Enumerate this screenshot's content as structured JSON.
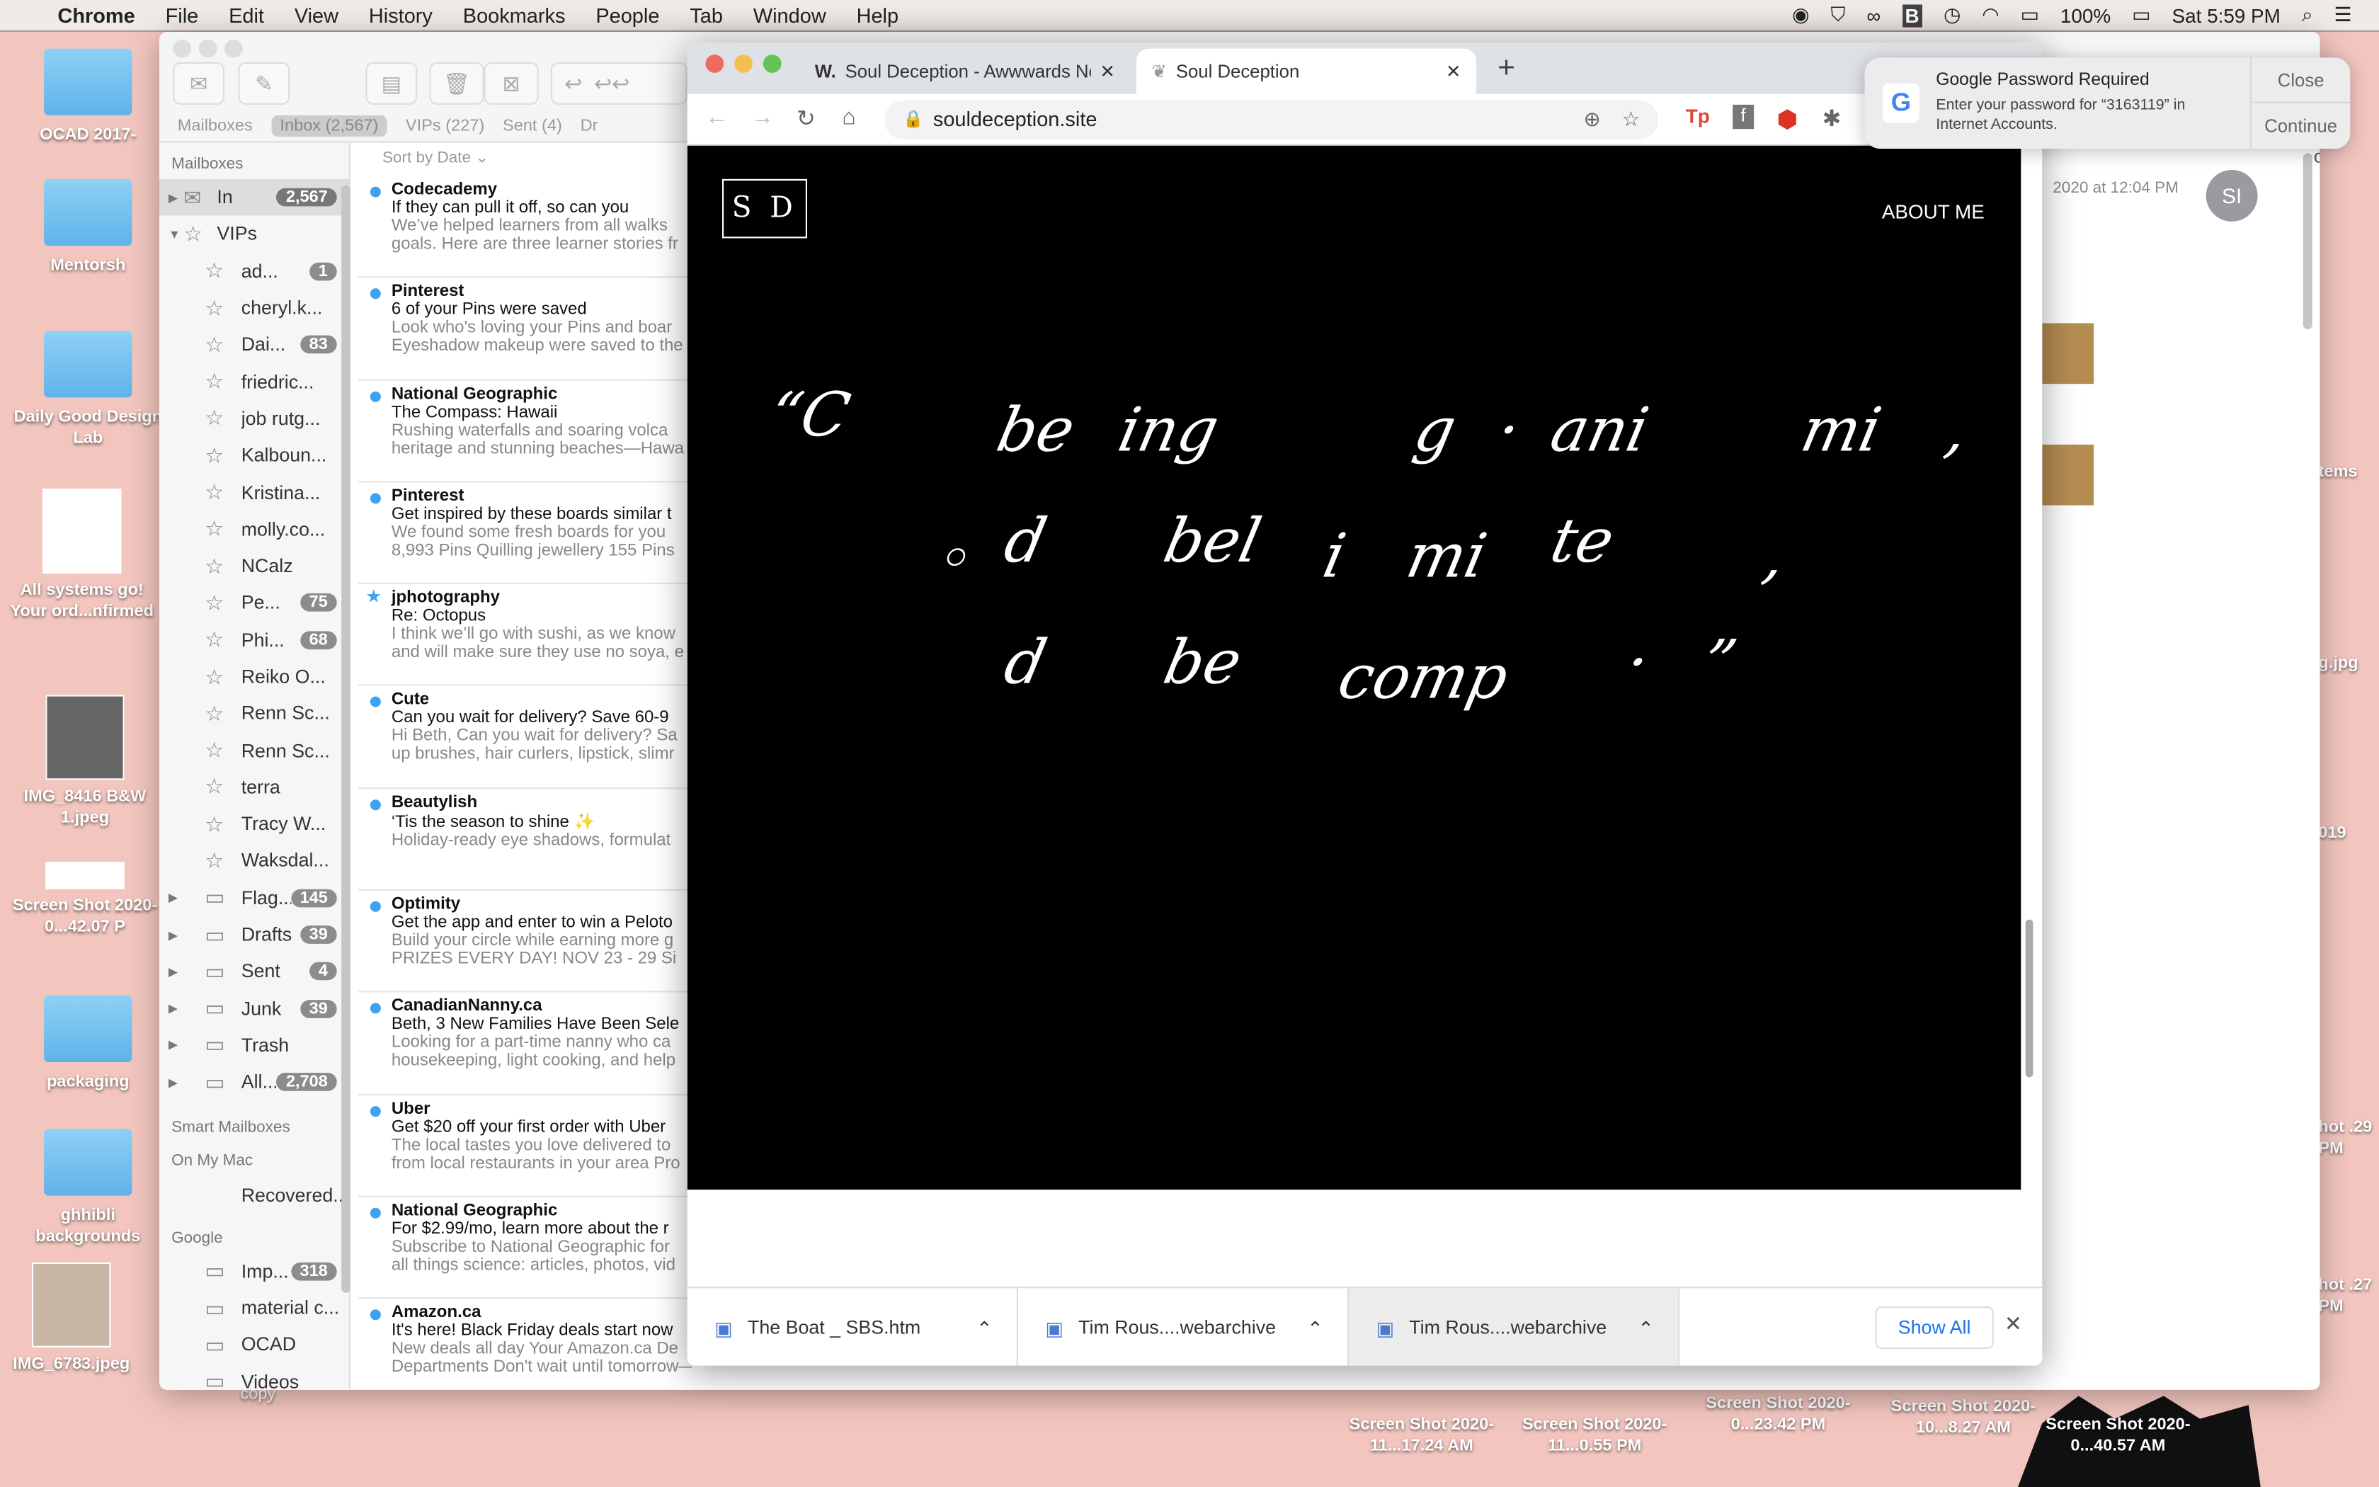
{
  "menubar": {
    "app": "Chrome",
    "items": [
      "File",
      "Edit",
      "View",
      "History",
      "Bookmarks",
      "People",
      "Tab",
      "Window",
      "Help"
    ],
    "battery": "100%",
    "clock": "Sat 5:59 PM"
  },
  "desktop": {
    "left": [
      "OCAD 2017-",
      "Mentorsh",
      "Daily Good Design Lab",
      "All systems go! Your ord...nfirmed",
      "IMG_8416 B&W 1.jpeg",
      "Screen Shot 2020-0...42.07 P",
      "packaging",
      "ghhibli backgrounds",
      "IMG_6783.jpeg"
    ],
    "bottom": [
      "Screen Shot 2020-11...17.24 AM",
      "Screen Shot 2020-11...0.55 PM",
      "Screen Shot 2020-0...23.42 PM",
      "Screen Shot 2020-10...8.27 AM",
      "Screen Shot 2020-0...40.57 AM"
    ],
    "right": [
      "n.ca items",
      "g.jpg",
      "019",
      "hot .29 PM",
      "hot .27 PM"
    ],
    "copy": "copy"
  },
  "mail": {
    "favorites": [
      "Mailboxes",
      "Inbox (2,567)",
      "VIPs (227)",
      "Sent (4)",
      "Dr"
    ],
    "sidebar": {
      "header": "Mailboxes",
      "inbox": {
        "label": "In",
        "count": "2,567"
      },
      "vips": "VIPs",
      "vip_items": [
        {
          "label": "ad...",
          "count": "1"
        },
        {
          "label": "cheryl.k..."
        },
        {
          "label": "Dai...",
          "count": "83"
        },
        {
          "label": "friedric..."
        },
        {
          "label": "job rutg..."
        },
        {
          "label": "Kalboun..."
        },
        {
          "label": "Kristina..."
        },
        {
          "label": "molly.co..."
        },
        {
          "label": "NCalz"
        },
        {
          "label": "Pe...",
          "count": "75"
        },
        {
          "label": "Phi...",
          "count": "68"
        },
        {
          "label": "Reiko O..."
        },
        {
          "label": "Renn Sc..."
        },
        {
          "label": "Renn Sc..."
        },
        {
          "label": "terra"
        },
        {
          "label": "Tracy W..."
        },
        {
          "label": "Waksdal..."
        }
      ],
      "boxes": [
        {
          "label": "Flag...",
          "count": "145"
        },
        {
          "label": "Drafts",
          "count": "39"
        },
        {
          "label": "Sent",
          "count": "4"
        },
        {
          "label": "Junk",
          "count": "39"
        },
        {
          "label": "Trash"
        },
        {
          "label": "All...",
          "count": "2,708"
        }
      ],
      "smart": "Smart Mailboxes",
      "onmac": "On My Mac",
      "recovered": "Recovered...",
      "google": "Google",
      "google_items": [
        {
          "label": "Imp...",
          "count": "318"
        },
        {
          "label": "material c..."
        },
        {
          "label": "OCAD"
        },
        {
          "label": "Videos"
        }
      ]
    },
    "sort": "Sort by Date",
    "messages": [
      {
        "from": "Codecademy",
        "subject": "If they can pull it off, so can you",
        "preview": [
          "We’ve helped learners from all walks",
          "goals. Here are three learner stories fr"
        ]
      },
      {
        "from": "Pinterest",
        "subject": "6 of your Pins were saved",
        "preview": [
          "Look who's loving your Pins and boar",
          "Eyeshadow makeup were saved to the"
        ]
      },
      {
        "from": "National Geographic",
        "subject": "The Compass: Hawaii",
        "preview": [
          "Rushing waterfalls and soaring volca",
          "heritage and stunning beaches—Hawa"
        ]
      },
      {
        "from": "Pinterest",
        "subject": "Get inspired by these boards similar t",
        "preview": [
          "We found some fresh boards for you",
          "8,993 Pins Quilling jewellery 155 Pins"
        ]
      },
      {
        "from": "jphotography",
        "subject": "Re: Octopus",
        "preview": [
          "I think we’ll go with sushi, as we know",
          "and will make sure they use no soya, e"
        ],
        "starred": true
      },
      {
        "from": "Cute",
        "subject": "Can you wait for delivery? Save 60-9",
        "preview": [
          "Hi Beth, Can you wait for delivery? Sa",
          "up brushes, hair curlers, lipstick, slimr"
        ]
      },
      {
        "from": "Beautylish",
        "subject": "‘Tis the season to shine ✨",
        "preview": [
          "Holiday-ready eye shadows, formulat",
          ""
        ]
      },
      {
        "from": "Optimity",
        "subject": "Get the app and enter to win a Peloto",
        "preview": [
          "Build your circle while earning more g",
          "PRIZES EVERY DAY!  NOV 23 - 29   Si"
        ]
      },
      {
        "from": "CanadianNanny.ca",
        "subject": "Beth, 3 New Families Have Been Sele",
        "preview": [
          "Looking for a part-time nanny who ca",
          "housekeeping, light cooking, and help"
        ]
      },
      {
        "from": "Uber",
        "subject": "Get $20 off your first order with Uber",
        "preview": [
          "The local tastes you love delivered to",
          "from local restaurants in your area Pro"
        ]
      },
      {
        "from": "National Geographic",
        "subject": "For $2.99/mo, learn more about the r",
        "preview": [
          "Subscribe to National Geographic for",
          "all things science: articles, photos, vid"
        ]
      },
      {
        "from": "Amazon.ca",
        "subject": "It's here! Black Friday deals start now",
        "preview": [
          "New deals all day Your Amazon.ca De",
          "Departments Don't wait until tomorrow—Black Friday deals..."
        ]
      }
    ],
    "detail": {
      "date": "2020 at 12:04 PM",
      "avatar": "SI",
      "of": "of"
    }
  },
  "chrome": {
    "tabs": [
      {
        "icon": "W.",
        "title": "Soul Deception - Awwwards No"
      },
      {
        "title": "Soul Deception"
      }
    ],
    "url": "souldeception.site",
    "page": {
      "logo": "S D",
      "nav": "ABOUT ME",
      "words": [
        "“C",
        "be",
        "ing",
        "g",
        "·",
        "ani",
        "mi",
        "‚",
        "◦",
        "d",
        "bel",
        "i",
        "mi",
        "te",
        "‚",
        "d",
        "be",
        "comp",
        "·",
        "”"
      ]
    },
    "downloads": [
      "The Boat _ SBS.htm",
      "Tim Rous....webarchive",
      "Tim Rous....webarchive"
    ],
    "show_all": "Show All"
  },
  "notification": {
    "title": "Google Password Required",
    "body": "Enter your password for “3163119” in Internet Accounts.",
    "close": "Close",
    "continue": "Continue"
  }
}
